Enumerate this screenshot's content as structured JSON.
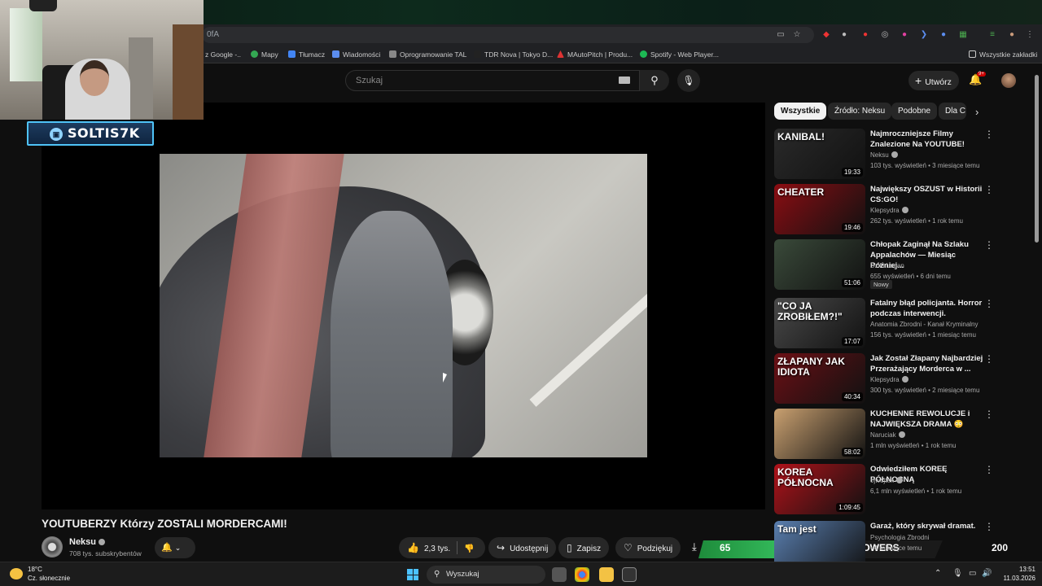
{
  "browser": {
    "url_fragment": "0fA",
    "bookmarks": [
      {
        "label": "z Google -..",
        "color": "#4285f4"
      },
      {
        "label": "Mapy",
        "color": "#34a853"
      },
      {
        "label": "Tłumacz",
        "color": "#4285f4"
      },
      {
        "label": "Wiadomości",
        "color": "#5b8def"
      },
      {
        "label": "Oprogramowanie TAL",
        "color": "#888888"
      },
      {
        "label": "TDR Nova | Tokyo D...",
        "color": "#222222"
      },
      {
        "label": "MAutoPitch | Produ...",
        "color": "#d33"
      },
      {
        "label": "Spotify - Web Player...",
        "color": "#1db954"
      }
    ],
    "all_bookmarks": "Wszystkie zakładki"
  },
  "youtube": {
    "search_placeholder": "Szukaj",
    "create_label": "Utwórz",
    "notif_count": "9+"
  },
  "overlay": {
    "streamer": "SOLTIS7K",
    "followers_current": "65",
    "followers_label": "FOLLOWERS",
    "followers_goal": "200",
    "followers_progress": 0.325
  },
  "video": {
    "title": "YOUTUBERZY Którzy ZOSTALI MORDERCAMI!",
    "channel": "Neksu",
    "subscribers": "708 tys. subskrybentów",
    "likes": "2,3 tys.",
    "share": "Udostępnij",
    "save": "Zapisz",
    "thanks": "Podziękuj"
  },
  "chips": [
    "Wszystkie",
    "Źródło: Neksu",
    "Podobne",
    "Dla C"
  ],
  "recommendations": [
    {
      "title": "Najmroczniejsze Filmy Znalezione Na YOUTUBE!",
      "channel": "Neksu",
      "views": "103 tys. wyświetleń • 3 miesiące temu",
      "duration": "19:33",
      "thumb_text": "KANIBAL!",
      "thumb_bg": "#2a2a2a",
      "verified": true
    },
    {
      "title": "Największy OSZUST w Historii CS:GO!",
      "channel": "Klepsydra",
      "views": "262 tys. wyświetleń • 1 rok temu",
      "duration": "19:46",
      "thumb_text": "CHEATER",
      "thumb_bg": "#8b0d12",
      "verified": true
    },
    {
      "title": "Chłopak Zaginął Na Szlaku Appalachów — Miesiąc Później...",
      "channel": "Dziki Logan",
      "views": "655 wyświetleń • 6 dni temu",
      "duration": "51:06",
      "thumb_text": "",
      "thumb_bg": "#3a4a3a",
      "verified": false,
      "badge": "Nowy"
    },
    {
      "title": "Fatalny błąd policjanta. Horror podczas interwencji.",
      "channel": "Anatomia Zbrodni - Kanał Kryminalny",
      "views": "156 tys. wyświetleń • 1 miesiąc temu",
      "duration": "17:07",
      "thumb_text": "\"CO JA ZROBIŁEM?!\"",
      "thumb_bg": "#4a4a4a",
      "verified": false
    },
    {
      "title": "Jak Został Złapany Najbardziej Przerażający Morderca w ...",
      "channel": "Klepsydra",
      "views": "300 tys. wyświetleń • 2 miesiące temu",
      "duration": "40:34",
      "thumb_text": "ZŁAPANY JAK IDIOTA",
      "thumb_bg": "#6b1015",
      "verified": true
    },
    {
      "title": "KUCHENNE REWOLUCJE i NAJWIĘKSZA DRAMA 😳",
      "channel": "Naruciak",
      "views": "1 mln wyświetleń • 1 rok temu",
      "duration": "58:02",
      "thumb_text": "",
      "thumb_bg": "#c9a070",
      "verified": true
    },
    {
      "title": "Odwiedziłem KOREĘ PÓŁNOCNĄ",
      "channel": "ojwojtek",
      "views": "6,1 mln wyświetleń • 1 rok temu",
      "duration": "1:09:45",
      "thumb_text": "KOREA PÓŁNOCNA",
      "thumb_bg": "#b0121a",
      "verified": true
    },
    {
      "title": "Garaż, który skrywał dramat.",
      "channel": "Psychologia Zbrodni",
      "views": "• 4 miesiące temu",
      "duration": "",
      "thumb_text": "Tam jest",
      "thumb_bg": "#5a7fb0",
      "verified": false
    }
  ],
  "taskbar": {
    "temp": "18°C",
    "weather": "Cz. słonecznie",
    "search": "Wyszukaj",
    "time": "13:51",
    "date": "11.03.2026"
  }
}
